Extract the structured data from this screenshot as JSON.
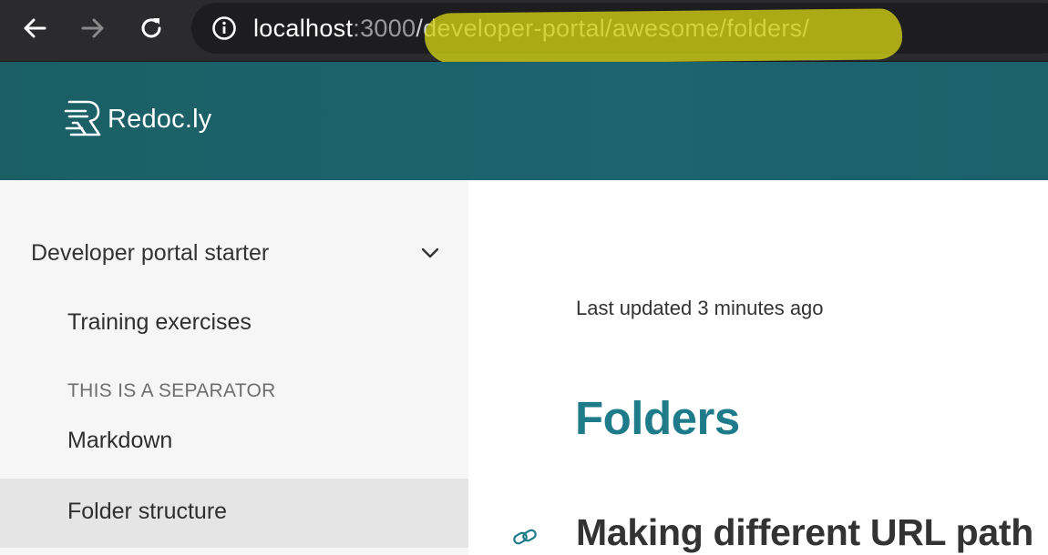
{
  "browser": {
    "url_host": "localhost",
    "url_port": ":3000",
    "url_path": "/developer-portal/awesome/folders/",
    "icons": {
      "back": "arrow-left-icon",
      "forward": "arrow-right-icon",
      "reload": "reload-icon",
      "info": "info-icon"
    },
    "highlight_color": "#d4d214"
  },
  "header": {
    "logo_text": "Redoc.ly",
    "background_color": "#1c616c"
  },
  "sidebar": {
    "group_label": "Developer portal starter",
    "items": [
      {
        "label": "Training exercises"
      },
      {
        "label": "Markdown"
      },
      {
        "label": "Folder structure",
        "active": true
      }
    ],
    "separator": "THIS IS A SEPARATOR"
  },
  "main": {
    "last_updated": "Last updated 3 minutes ago",
    "title": "Folders",
    "section_heading": "Making different URL path",
    "title_color": "#1e7b8a"
  }
}
